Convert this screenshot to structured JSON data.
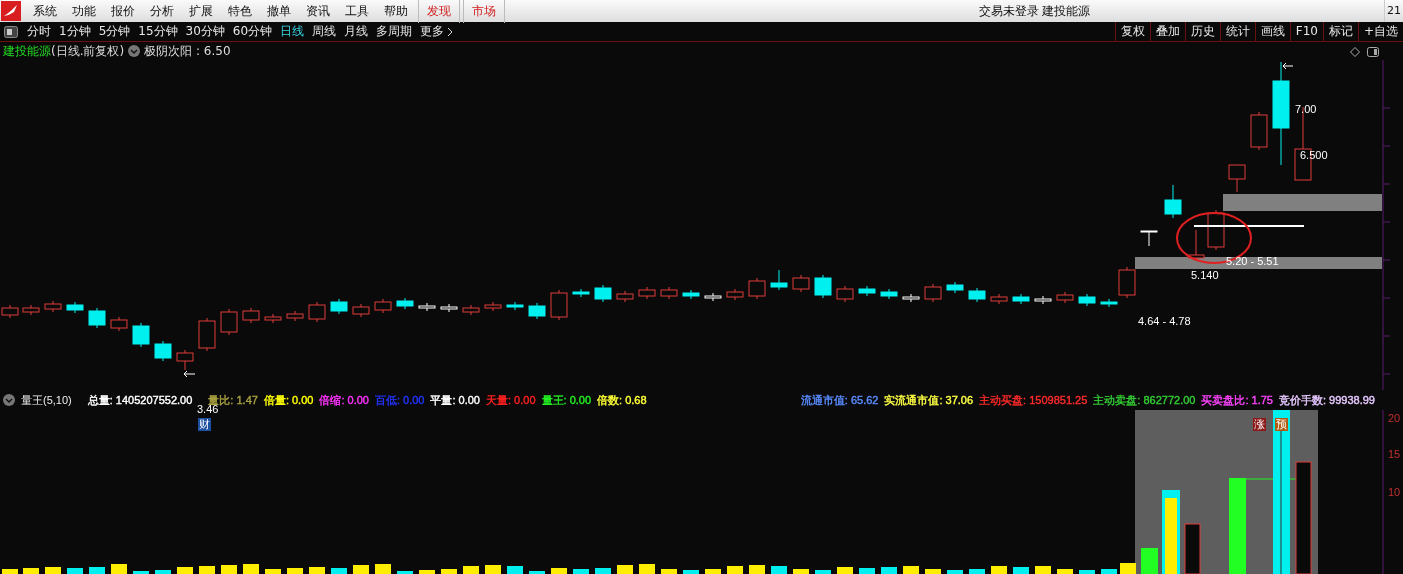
{
  "menu": [
    {
      "label": "系统",
      "accent": false
    },
    {
      "label": "功能",
      "accent": false
    },
    {
      "label": "报价",
      "accent": false
    },
    {
      "label": "分析",
      "accent": false
    },
    {
      "label": "扩展",
      "accent": false
    },
    {
      "label": "特色",
      "accent": false
    },
    {
      "label": "撤单",
      "accent": false
    },
    {
      "label": "资讯",
      "accent": false
    },
    {
      "label": "工具",
      "accent": false
    },
    {
      "label": "帮助",
      "accent": false
    },
    {
      "label": "发现",
      "accent": true
    },
    {
      "label": "市场",
      "accent": true
    }
  ],
  "title": "交易未登录  建投能源",
  "corner": "21",
  "periods": [
    {
      "label": "分时",
      "selected": false
    },
    {
      "label": "1分钟",
      "selected": false
    },
    {
      "label": "5分钟",
      "selected": false
    },
    {
      "label": "15分钟",
      "selected": false
    },
    {
      "label": "30分钟",
      "selected": false
    },
    {
      "label": "60分钟",
      "selected": false
    },
    {
      "label": "日线",
      "selected": true
    },
    {
      "label": "周线",
      "selected": false
    },
    {
      "label": "月线",
      "selected": false
    },
    {
      "label": "多周期",
      "selected": false
    },
    {
      "label": "更多",
      "selected": false
    }
  ],
  "tools": [
    "复权",
    "叠加",
    "历史",
    "统计",
    "画线",
    "F10",
    "标记",
    "+自选"
  ],
  "chart_info": {
    "stock": "建投能源",
    "mode": "(日线.前复权)",
    "indicator": "极阴次阳 : 6.50"
  },
  "annotations": [
    "7.00",
    "6.500",
    "5.20 - 5.51",
    "5.140",
    "4.64 - 4.78",
    "3.46"
  ],
  "markers": [
    {
      "label": "财",
      "color": "#1c4fa0"
    },
    {
      "label": "涨",
      "color": "#8c1a1a"
    },
    {
      "label": "预",
      "color": "#b05a10"
    }
  ],
  "indicator_bar": {
    "name": "量王(5,10)",
    "left": [
      {
        "text": "总量: 1405207552.00",
        "color": "#ffffff"
      },
      {
        "text": "量比: 1.47",
        "color": "#a8a040"
      },
      {
        "text": "倍量: 0.00",
        "color": "#ffff00"
      },
      {
        "text": "倍缩: 0.00",
        "color": "#ff33ff"
      },
      {
        "text": "百低: 0.00",
        "color": "#2233ff"
      },
      {
        "text": "平量: 0.00",
        "color": "#ffffff"
      },
      {
        "text": "天量: 0.00",
        "color": "#ff2020"
      },
      {
        "text": "量王: 0.00",
        "color": "#22ee22"
      },
      {
        "text": "倍数: 0.68",
        "color": "#ffff33"
      }
    ],
    "right": [
      {
        "text": "流通市值: 65.62",
        "color": "#5a8cff"
      },
      {
        "text": "实流通市值: 37.06",
        "color": "#ffff44"
      },
      {
        "text": "主动买盘: 1509851.25",
        "color": "#ff2a2a"
      },
      {
        "text": "主动卖盘: 862772.00",
        "color": "#33cc33"
      },
      {
        "text": "买卖盘比: 1.75",
        "color": "#ff44ff"
      },
      {
        "text": "竞价手数: 99938.99",
        "color": "#e6c8ff"
      }
    ]
  },
  "volume_axis": [
    "20",
    "15",
    "10"
  ]
}
